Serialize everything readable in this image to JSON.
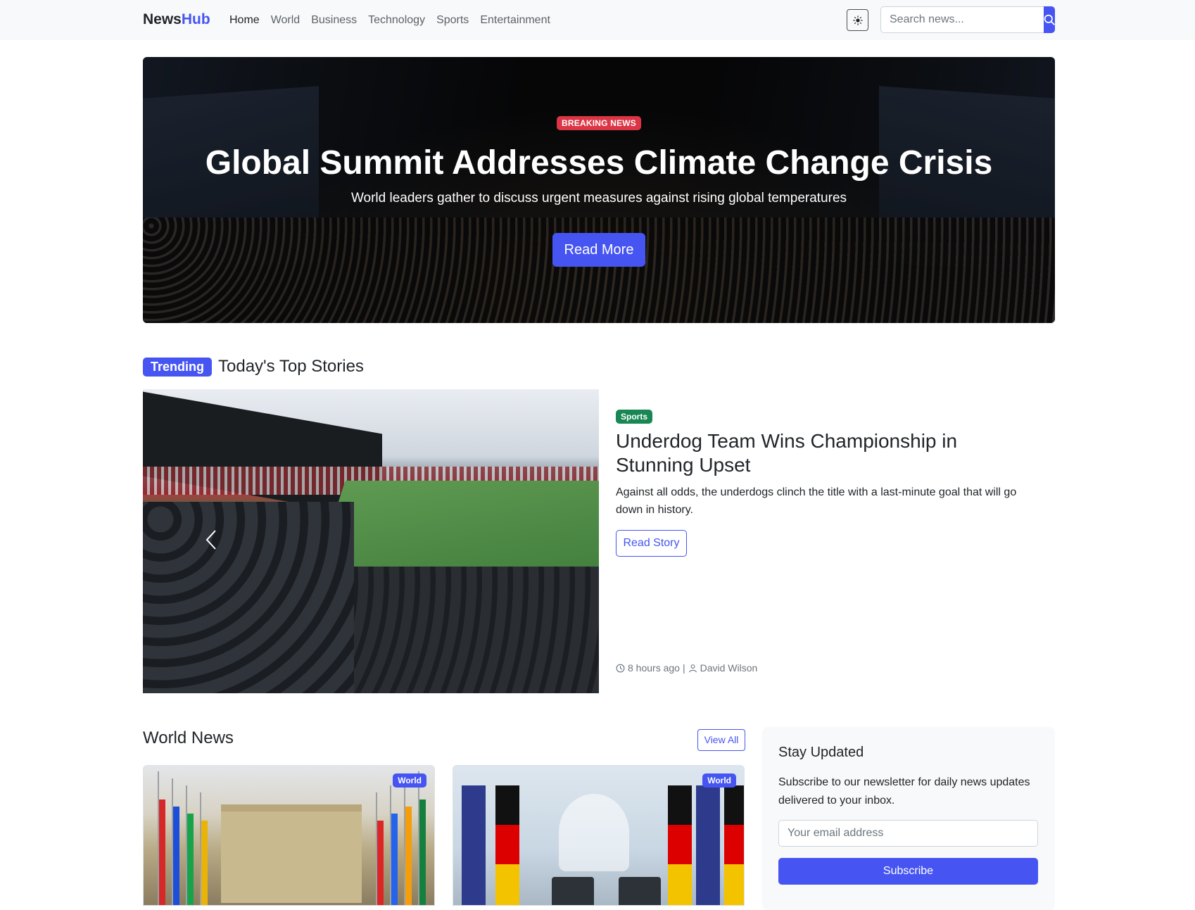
{
  "navbar": {
    "brand_part1": "News",
    "brand_part2": "Hub",
    "links": [
      "Home",
      "World",
      "Business",
      "Technology",
      "Sports",
      "Entertainment"
    ],
    "active_link": "Home",
    "theme_toggle_icon": "sun-icon",
    "search_placeholder": "Search news...",
    "search_icon": "search-icon"
  },
  "hero": {
    "badge": "BREAKING NEWS",
    "title": "Global Summit Addresses Climate Change Crisis",
    "subtitle": "World leaders gather to discuss urgent measures against rising global temperatures",
    "button": "Read More"
  },
  "trending": {
    "badge": "Trending",
    "heading": "Today's Top Stories",
    "story": {
      "category": "Sports",
      "title": "Underdog Team Wins Championship in Stunning Upset",
      "description": "Against all odds, the underdogs clinch the title with a last-minute goal that will go down in history.",
      "button": "Read Story",
      "time": "8 hours ago",
      "separator": "|",
      "author": "David Wilson"
    }
  },
  "world_news": {
    "heading": "World News",
    "view_all": "View All",
    "cards": [
      {
        "badge": "World"
      },
      {
        "badge": "World"
      }
    ]
  },
  "newsletter": {
    "title": "Stay Updated",
    "text": "Subscribe to our newsletter for daily news updates delivered to your inbox.",
    "placeholder": "Your email address",
    "button": "Subscribe"
  },
  "colors": {
    "primary": "#4655f2",
    "danger": "#dc3545",
    "success": "#198754",
    "navbar_bg": "#f8f9fa"
  }
}
